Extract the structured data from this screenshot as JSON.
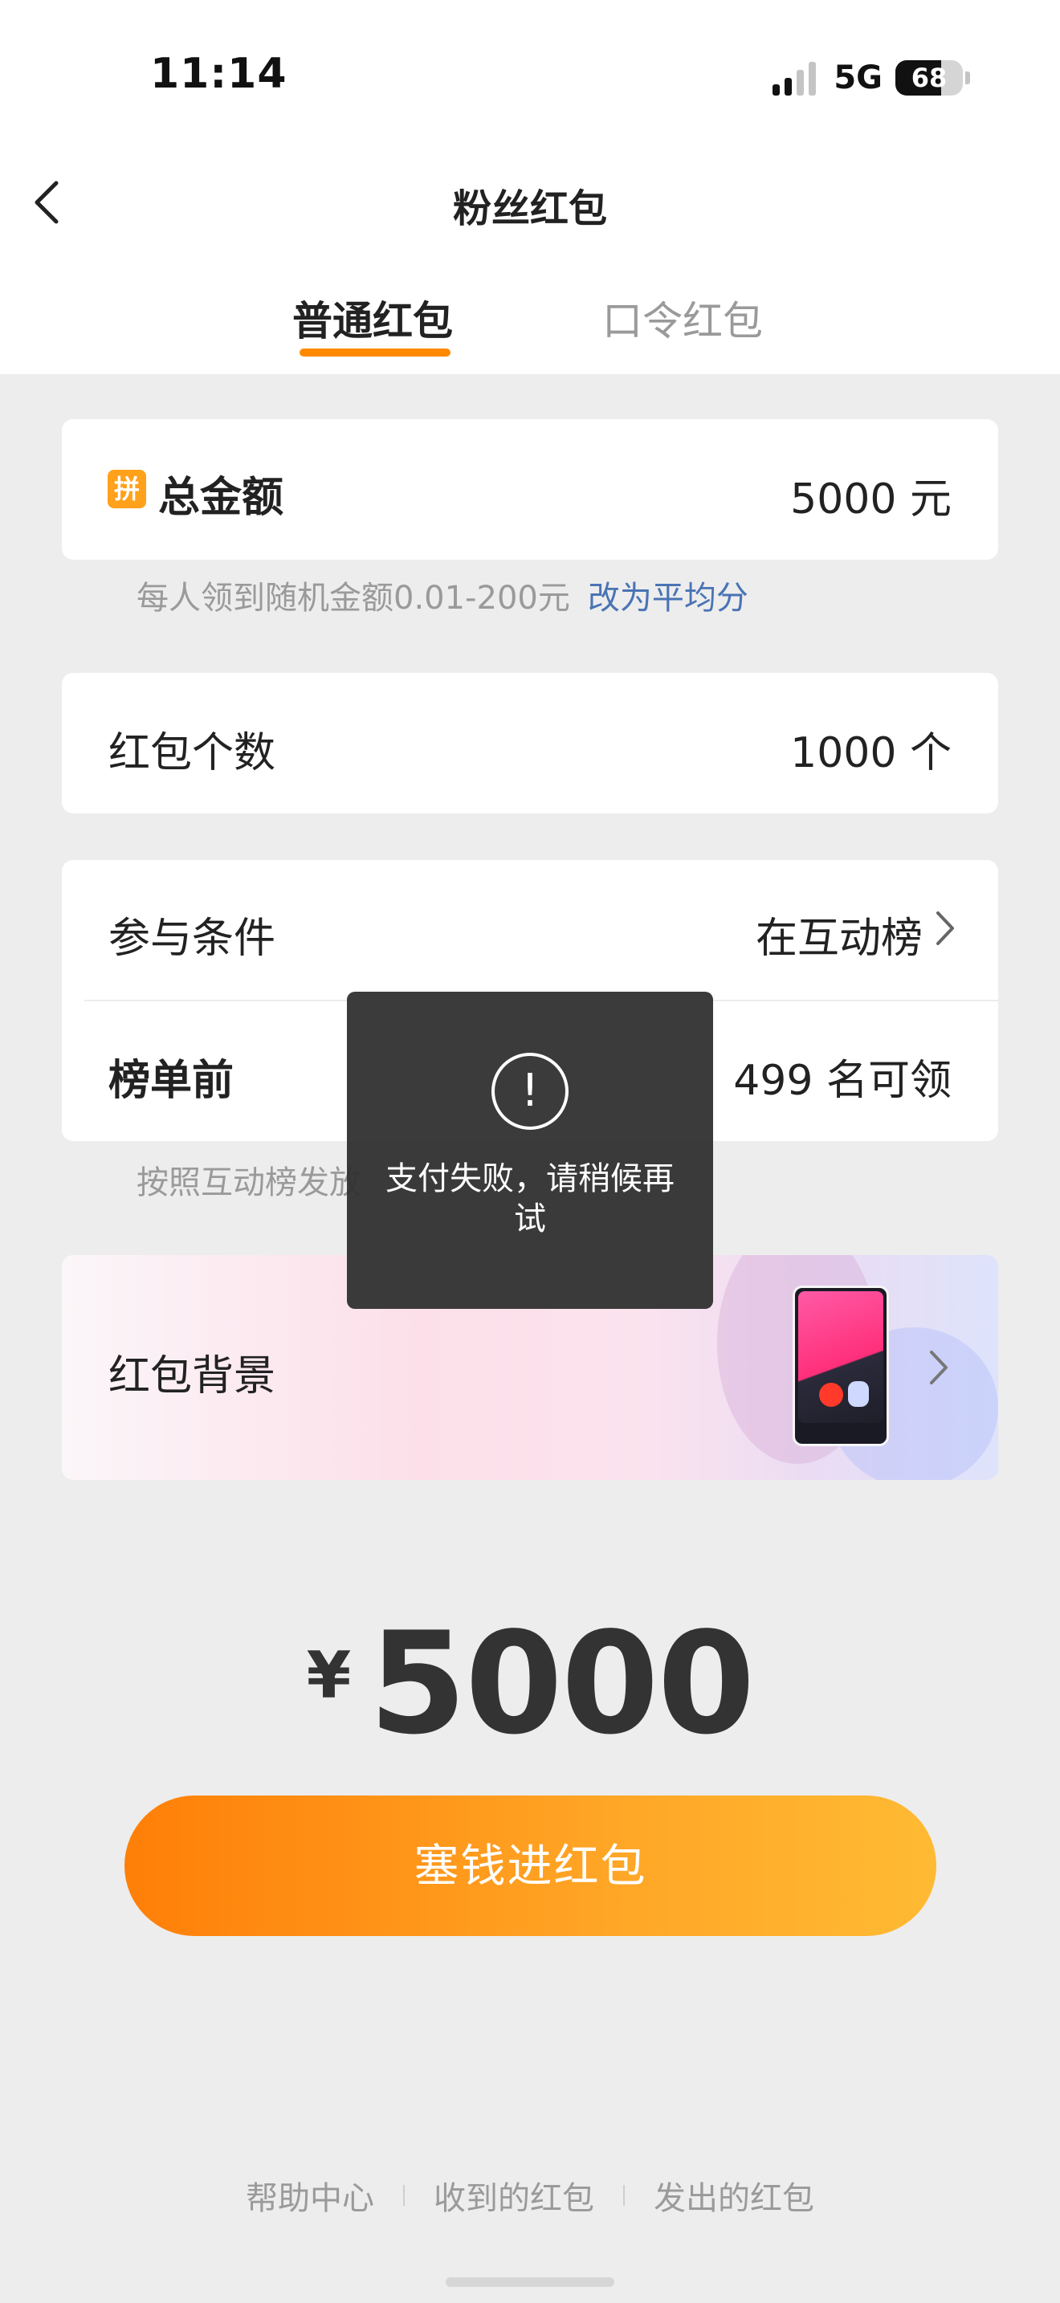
{
  "status_bar": {
    "time": "11:14",
    "network": "5G",
    "battery": "68",
    "battery_level": 0.68
  },
  "header": {
    "title": "粉丝红包"
  },
  "tabs": [
    {
      "label": "普通红包",
      "active": true
    },
    {
      "label": "口令红包",
      "active": false
    }
  ],
  "total_amount": {
    "icon_label": "拼",
    "label": "总金额",
    "value": "5000 元"
  },
  "amount_hint": {
    "text": "每人领到随机金额0.01-200元",
    "link": "改为平均分"
  },
  "packet_count": {
    "label": "红包个数",
    "value": "1000 个"
  },
  "conditions": {
    "label": "参与条件",
    "value": "在互动榜",
    "rank_label": "榜单前",
    "rank_value": "499 名可领",
    "hint": "按照互动榜发放"
  },
  "background": {
    "label": "红包背景"
  },
  "total": {
    "currency": "¥",
    "amount": "5000"
  },
  "pay_button": {
    "label": "塞钱进红包"
  },
  "footer": {
    "links": [
      "帮助中心",
      "收到的红包",
      "发出的红包"
    ]
  },
  "toast": {
    "icon": "!",
    "message": "支付失败，请稍候再试"
  },
  "colors": {
    "accent": "#ff8a00",
    "link": "#4a74b4",
    "icon_bg": "#ffa11a"
  }
}
